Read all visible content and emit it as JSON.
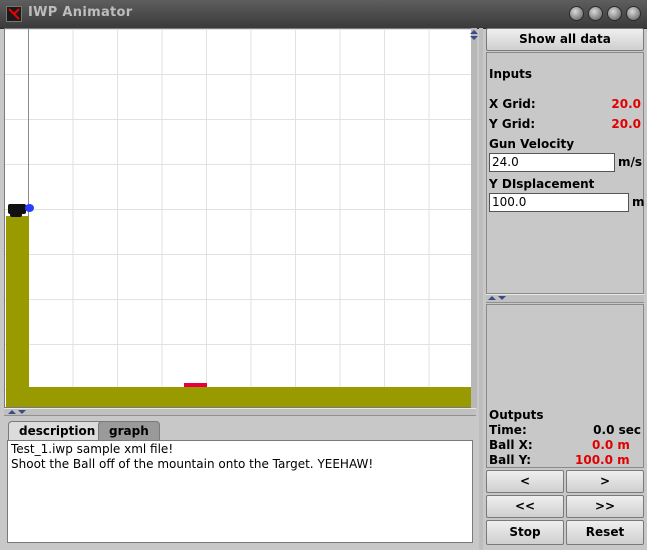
{
  "window": {
    "title": "IWP Animator"
  },
  "tabs": [
    {
      "label": "description"
    },
    {
      "label": "graph"
    }
  ],
  "description": {
    "line1": "Test_1.iwp sample xml file!",
    "line2": "Shoot the Ball off of the mountain onto the Target.  YEEHAW!"
  },
  "controls": {
    "show_all": "Show all data",
    "prev": "<",
    "next": ">",
    "rewind": "<<",
    "forward": ">>",
    "stop": "Stop",
    "reset": "Reset"
  },
  "inputs": {
    "heading": "Inputs",
    "x_grid_label": "X Grid:",
    "x_grid_value": "20.0",
    "y_grid_label": "Y Grid:",
    "y_grid_value": "20.0",
    "gun_velocity_label": "Gun Velocity",
    "gun_velocity_value": "24.0",
    "gun_velocity_unit": "m/s",
    "y_displacement_label": "Y DIsplacement",
    "y_displacement_value": "100.0",
    "y_displacement_unit": "m"
  },
  "outputs": {
    "heading": "Outputs",
    "time_label": "Time:",
    "time_value": "0.0 sec",
    "ball_x_label": "Ball X:",
    "ball_x_value": "0.0 m",
    "ball_y_label": "Ball Y:",
    "ball_y_value": "100.0 m"
  },
  "colors": {
    "title_bar": "#4a4a4a",
    "ground": "#999900",
    "ball": "#2a3cff",
    "target": "#e8003a",
    "value_red": "#e00000"
  }
}
